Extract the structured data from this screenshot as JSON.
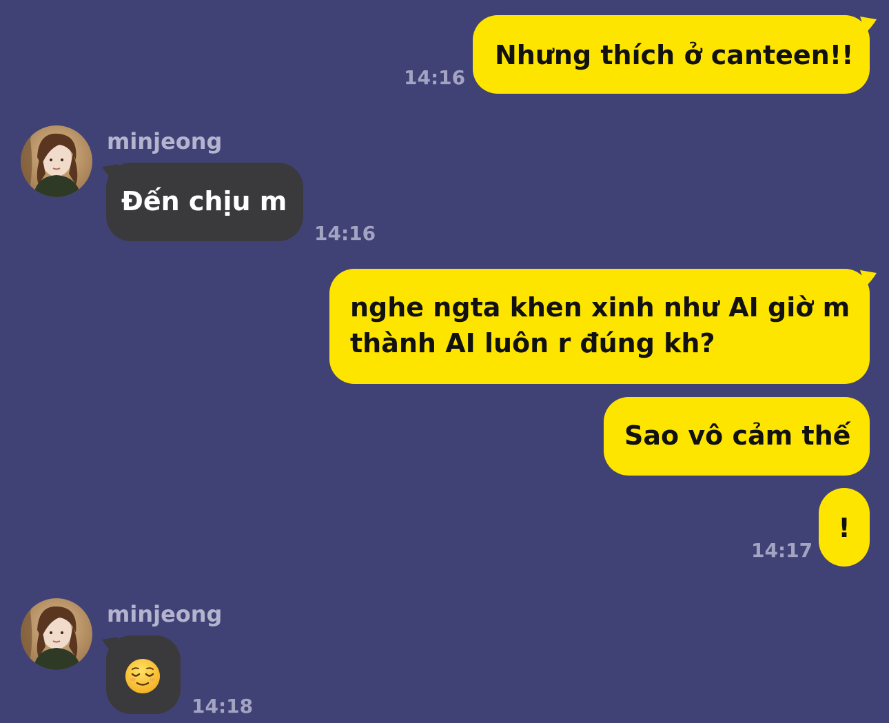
{
  "app": {
    "theme_background": "#404276",
    "my_bubble_color": "#FEE500",
    "their_bubble_color": "#3A3A3C"
  },
  "messages": [
    {
      "sender": "me",
      "text": "Nhưng thích ở canteen!!",
      "time": "14:16"
    },
    {
      "sender": "minjeong",
      "name": "minjeong",
      "text": "Đến chịu m",
      "time": "14:16"
    },
    {
      "sender": "me",
      "text_line1": "nghe ngta khen xinh như AI giờ m",
      "text_line2": "thành AI luôn r đúng kh?"
    },
    {
      "sender": "me",
      "text": "Sao vô cảm thế"
    },
    {
      "sender": "me",
      "text": "!",
      "time": "14:17"
    },
    {
      "sender": "minjeong",
      "name": "minjeong",
      "emoji": "relieved-face-emoji",
      "time": "14:18"
    }
  ]
}
